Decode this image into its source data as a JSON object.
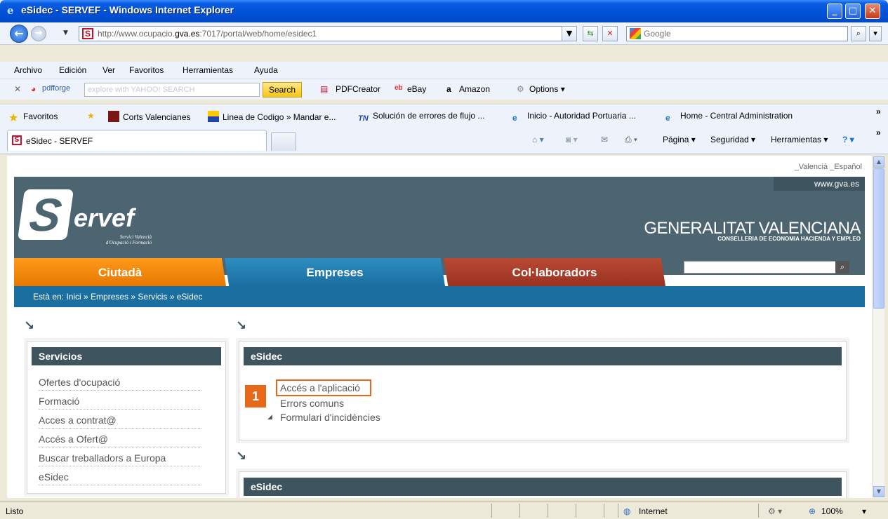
{
  "window": {
    "title": "eSidec - SERVEF - Windows Internet Explorer",
    "minimize": "_",
    "maximize": "□",
    "close": "✕"
  },
  "address": {
    "url_prefix": "http://www.ocupacio.",
    "url_host": "gva.es",
    "url_suffix": ":7017/portal/web/home/esidec1",
    "search_placeholder": "Google"
  },
  "menu": [
    "Archivo",
    "Edición",
    "Ver",
    "Favoritos",
    "Herramientas",
    "Ayuda"
  ],
  "toolbar": {
    "pdfforge": "pdfforge",
    "yahoo_placeholder": "explore with YAHOO! SEARCH",
    "search_label": "Search",
    "pdfcreator": "PDFCreator",
    "ebay": "eBay",
    "amazon": "Amazon",
    "options": "Options"
  },
  "favorites": {
    "label": "Favoritos",
    "items": [
      "Corts Valencianes",
      "Linea de Codigo » Mandar e...",
      "Solución de errores de flujo ...",
      "Inicio - Autoridad Portuaria ...",
      "Home - Central Administration"
    ]
  },
  "tabs": {
    "active": "eSidec - SERVEF"
  },
  "commandbar": {
    "pagina": "Página",
    "seguridad": "Seguridad",
    "herramientas": "Herramientas"
  },
  "page": {
    "lang_links": "_Valencià _Español",
    "gva_link": "www.gva.es",
    "logo_letter": "S",
    "logo_text": "ervef",
    "logo_sub1": "Servici Valencià",
    "logo_sub2": "d'Ocupació i Formació",
    "gv_name": "GENERALITAT VALENCIANA",
    "gv_sub": "CONSELLERIA DE ECONOMIA HACIENDA Y EMPLEO",
    "nav": [
      "Ciutadà",
      "Empreses",
      "Col·laboradors"
    ],
    "breadcrumb": "Està en: Inici » Empreses » Servicis » eSidec",
    "services_title": "Servicios",
    "services": [
      "Ofertes d'ocupació",
      "Formació",
      "Acces a contrat@",
      "Accés a Ofert@",
      "Buscar treballadors a Europa",
      "eSidec"
    ],
    "esidec_title": "eSidec",
    "esidec_links": [
      "Accés a l'aplicació",
      "Errors comuns",
      "Formulari d'incidències"
    ],
    "badge_number": "1",
    "esidec_title2": "eSidec"
  },
  "status": {
    "text": "Listo",
    "zone": "Internet",
    "zoom": "100%"
  },
  "colors": {
    "accent_orange": "#E8681A",
    "header_slate": "#3E5560",
    "nav_blue": "#1A6EA0"
  }
}
